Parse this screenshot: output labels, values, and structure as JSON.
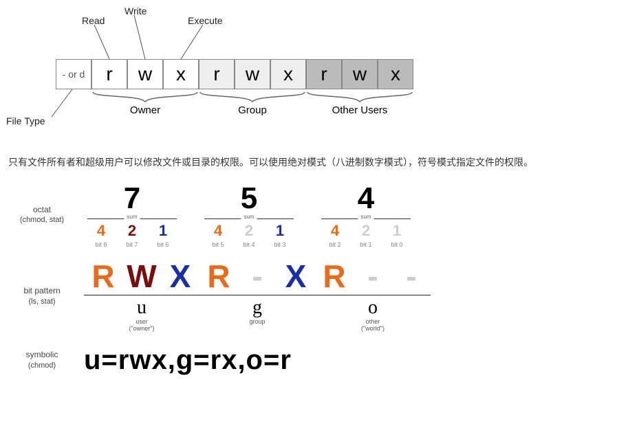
{
  "top": {
    "labels": {
      "read": "Read",
      "write": "Write",
      "execute": "Execute",
      "filetype": "File Type"
    },
    "cells": [
      "- or d",
      "r",
      "w",
      "x",
      "r",
      "w",
      "x",
      "r",
      "w",
      "x"
    ],
    "groups": {
      "owner": "Owner",
      "group": "Group",
      "other": "Other Users"
    }
  },
  "paragraph": "只有文件所有者和超级用户可以修改文件或目录的权限。可以使用绝对模式（八进制数字模式），符号模式指定文件的权限。",
  "side": {
    "octal_l1": "octat",
    "octal_l2": "(chmod, stat)",
    "pattern_l1": "bit pattern",
    "pattern_l2": "(ls, stat)",
    "symbolic_l1": "symbolic",
    "symbolic_l2": "(chmod)"
  },
  "octal": {
    "sum": "sum",
    "digits": [
      "7",
      "5",
      "4"
    ],
    "groups": [
      {
        "weights": [
          {
            "v": "4",
            "bit": "bit 8",
            "clr": "clr-orange"
          },
          {
            "v": "2",
            "bit": "bit 7",
            "clr": "clr-maroon"
          },
          {
            "v": "1",
            "bit": "bit 6",
            "clr": "clr-navy"
          }
        ]
      },
      {
        "weights": [
          {
            "v": "4",
            "bit": "bit 5",
            "clr": "clr-orange"
          },
          {
            "v": "2",
            "bit": "bit 4",
            "clr": "clr-grey"
          },
          {
            "v": "1",
            "bit": "bit 3",
            "clr": "clr-navy"
          }
        ]
      },
      {
        "weights": [
          {
            "v": "4",
            "bit": "bit 2",
            "clr": "clr-orange"
          },
          {
            "v": "2",
            "bit": "bit 1",
            "clr": "clr-grey"
          },
          {
            "v": "1",
            "bit": "bit 0",
            "clr": "clr-grey"
          }
        ]
      }
    ]
  },
  "pattern": {
    "letters": [
      {
        "t": "R",
        "clr": "clr-orange"
      },
      {
        "t": "W",
        "clr": "clr-maroon"
      },
      {
        "t": "X",
        "clr": "clr-navy"
      },
      {
        "t": "R",
        "clr": "clr-orange"
      },
      {
        "t": "-",
        "clr": "clr-grey"
      },
      {
        "t": "X",
        "clr": "clr-navy"
      },
      {
        "t": "R",
        "clr": "clr-orange"
      },
      {
        "t": "-",
        "clr": "clr-grey"
      },
      {
        "t": "-",
        "clr": "clr-grey"
      }
    ],
    "ugo": [
      {
        "l": "u",
        "s1": "user",
        "s2": "(\"owner\")"
      },
      {
        "l": "g",
        "s1": "group",
        "s2": ""
      },
      {
        "l": "o",
        "s1": "other",
        "s2": "(\"world\")"
      }
    ]
  },
  "symbolic": "u=rwx,g=rx,o=r"
}
